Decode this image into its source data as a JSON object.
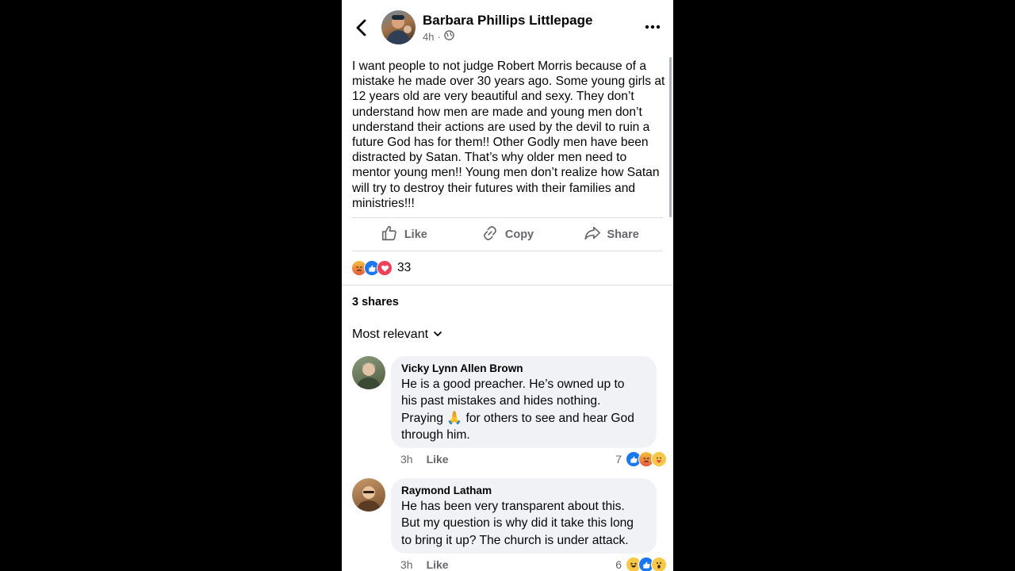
{
  "header": {
    "author": "Barbara Phillips Littlepage",
    "time": "4h",
    "separator": "·",
    "audience_icon": "globe-icon",
    "back_icon": "chevron-left-icon",
    "more_icon": "more-horizontal-icon"
  },
  "post": {
    "text": "I want people to not judge Robert Morris because of a mistake he made over 30 years ago.  Some young girls at 12 years old are very beautiful and sexy. They don’t understand how men are made and young men don’t understand their actions are used by the devil to ruin a future God has for them!! Other Godly men have been distracted by Satan. That’s why older men need to mentor young men!! Young men don’t realize how Satan will try to destroy their futures with their families and ministries!!!"
  },
  "actions": {
    "like": "Like",
    "copy": "Copy",
    "share": "Share"
  },
  "reactions": {
    "icons": [
      "angry",
      "like",
      "love"
    ],
    "count": "33"
  },
  "shares": "3 shares",
  "sort": {
    "label": "Most relevant"
  },
  "comments": [
    {
      "author": "Vicky Lynn Allen Brown",
      "text_lines": [
        "He is a good preacher. He’s owned up to",
        "his past mistakes and hides nothing.",
        "Praying",
        "for others to see and hear God",
        "through him."
      ],
      "emoji": "🙏",
      "time": "3h",
      "like_label": "Like",
      "reaction_count": "7",
      "reaction_icons": [
        "like",
        "angry",
        "care"
      ]
    },
    {
      "author": "Raymond Latham",
      "text_lines": [
        "He has been very transparent about this.",
        "But my question is why did it take this long",
        "to bring it up? The church is under attack."
      ],
      "time": "3h",
      "like_label": "Like",
      "reaction_count": "6",
      "reaction_icons": [
        "haha",
        "like",
        "wow"
      ]
    }
  ],
  "colors": {
    "background": "#000000",
    "card": "#ffffff",
    "text": "#050505",
    "secondary_text": "#65676b",
    "bubble": "#f0f2f5",
    "like_blue": "#1877f2",
    "love_red": "#f33e58"
  }
}
